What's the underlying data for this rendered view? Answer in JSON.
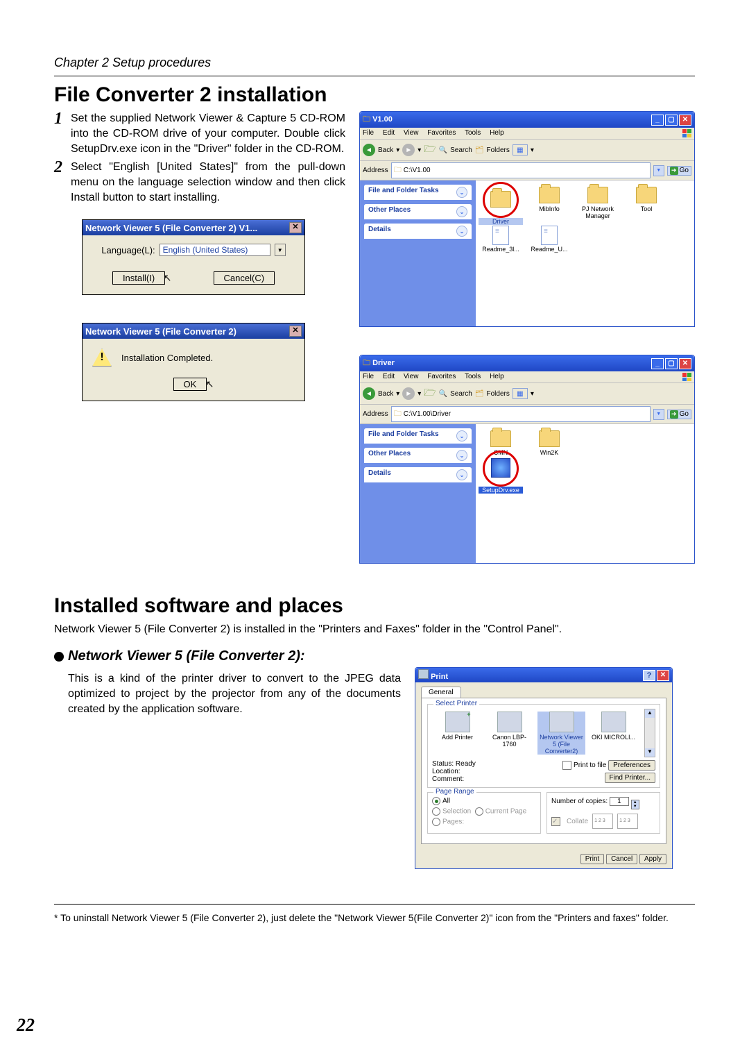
{
  "chapter": "Chapter 2 Setup procedures",
  "section1": "File Converter 2 installation",
  "step1_num": "1",
  "step1": "Set the supplied Network Viewer & Capture 5 CD-ROM into the CD-ROM drive of your computer. Double click SetupDrv.exe icon in the \"Driver\" folder in the CD-ROM.",
  "step2_num": "2",
  "step2": "Select \"English [United States]\" from the pull-down menu on the language selection window and then click Install button to start installing.",
  "lang_dialog": {
    "title": "Network Viewer 5 (File Converter 2) V1...",
    "label": "Language(L):",
    "value": "English (United States)",
    "install": "Install(I)",
    "cancel": "Cancel(C)"
  },
  "done_dialog": {
    "title": "Network Viewer 5 (File Converter 2)",
    "msg": "Installation Completed.",
    "ok": "OK"
  },
  "explorer_common": {
    "menu": [
      "File",
      "Edit",
      "View",
      "Favorites",
      "Tools",
      "Help"
    ],
    "back": "Back",
    "search": "Search",
    "folders": "Folders",
    "address": "Address",
    "go": "Go",
    "side": [
      "File and Folder Tasks",
      "Other Places",
      "Details"
    ]
  },
  "exp1": {
    "title": "V1.00",
    "path": "C:\\V1.00",
    "items": [
      "Driver",
      "MibInfo",
      "PJ Network Manager",
      "Tool",
      "Readme_3l...",
      "Readme_U..."
    ]
  },
  "exp2": {
    "title": "Driver",
    "path": "C:\\V1.00\\Driver",
    "items": [
      "CMN",
      "Win2K",
      "SetupDrv.exe"
    ]
  },
  "section2": "Installed software and places",
  "section2_text": "Network Viewer 5 (File Converter 2) is installed in the \"Printers and Faxes\" folder in the \"Control Panel\".",
  "sub_head": "Network Viewer 5 (File Converter 2):",
  "sub_text": "This is a kind of the printer driver to convert to the JPEG data optimized to project by the projector from any of the documents created by the application software.",
  "print": {
    "title": "Print",
    "tab": "General",
    "group_select": "Select Printer",
    "printers": [
      "Add Printer",
      "Canon LBP-1760",
      "Network Viewer 5 (File Converter2)",
      "OKI MICROLI..."
    ],
    "status_l": "Status:",
    "status_v": "Ready",
    "loc_l": "Location:",
    "com_l": "Comment:",
    "ptf": "Print to file",
    "pref": "Preferences",
    "find": "Find Printer...",
    "group_range": "Page Range",
    "all": "All",
    "selection": "Selection",
    "curpage": "Current Page",
    "pages": "Pages:",
    "copies_l": "Number of copies:",
    "copies_v": "1",
    "collate": "Collate",
    "btn_print": "Print",
    "btn_cancel": "Cancel",
    "btn_apply": "Apply"
  },
  "footnote": "* To uninstall Network Viewer 5 (File Converter 2), just delete the \"Network Viewer 5(File Converter 2)\" icon from the \"Printers and faxes\" folder.",
  "page_number": "22"
}
